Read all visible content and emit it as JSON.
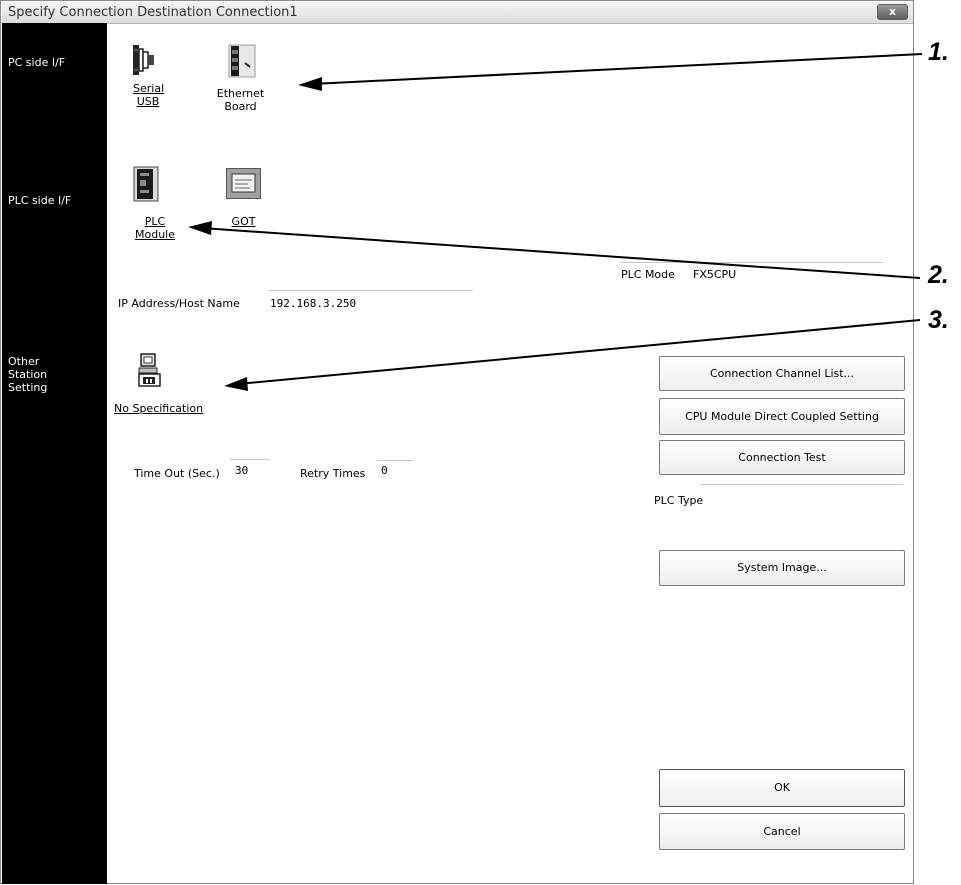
{
  "window": {
    "title": "Specify Connection Destination Connection1",
    "close_glyph": "x"
  },
  "left_panel": {
    "pc_side": "PC side I/F",
    "plc_side": "PLC side I/F",
    "other_station_lines": [
      "Other",
      "Station",
      "Setting"
    ]
  },
  "pc_side": {
    "serial_usb": [
      "Serial",
      "USB"
    ],
    "ethernet_board": [
      "Ethernet",
      "Board"
    ]
  },
  "plc_side": {
    "plc_module": [
      "PLC",
      "Module"
    ],
    "got": "GOT"
  },
  "plc_mode": {
    "label": "PLC Mode",
    "value": "FX5CPU"
  },
  "ip": {
    "label": "IP Address/Host Name",
    "value": "192.168.3.250"
  },
  "other_station": {
    "no_specification": "No Specification"
  },
  "timeout": {
    "label": "Time Out (Sec.)",
    "value": "30"
  },
  "retry": {
    "label": "Retry Times",
    "value": "0"
  },
  "buttons": {
    "connection_channel_list": "Connection Channel List...",
    "cpu_direct_coupled": "CPU Module Direct Coupled Setting",
    "connection_test": "Connection Test",
    "system_image": "System Image...",
    "ok": "OK",
    "cancel": "Cancel"
  },
  "plc_type": {
    "label": "PLC Type"
  },
  "callouts": [
    "1.",
    "2.",
    "3."
  ]
}
